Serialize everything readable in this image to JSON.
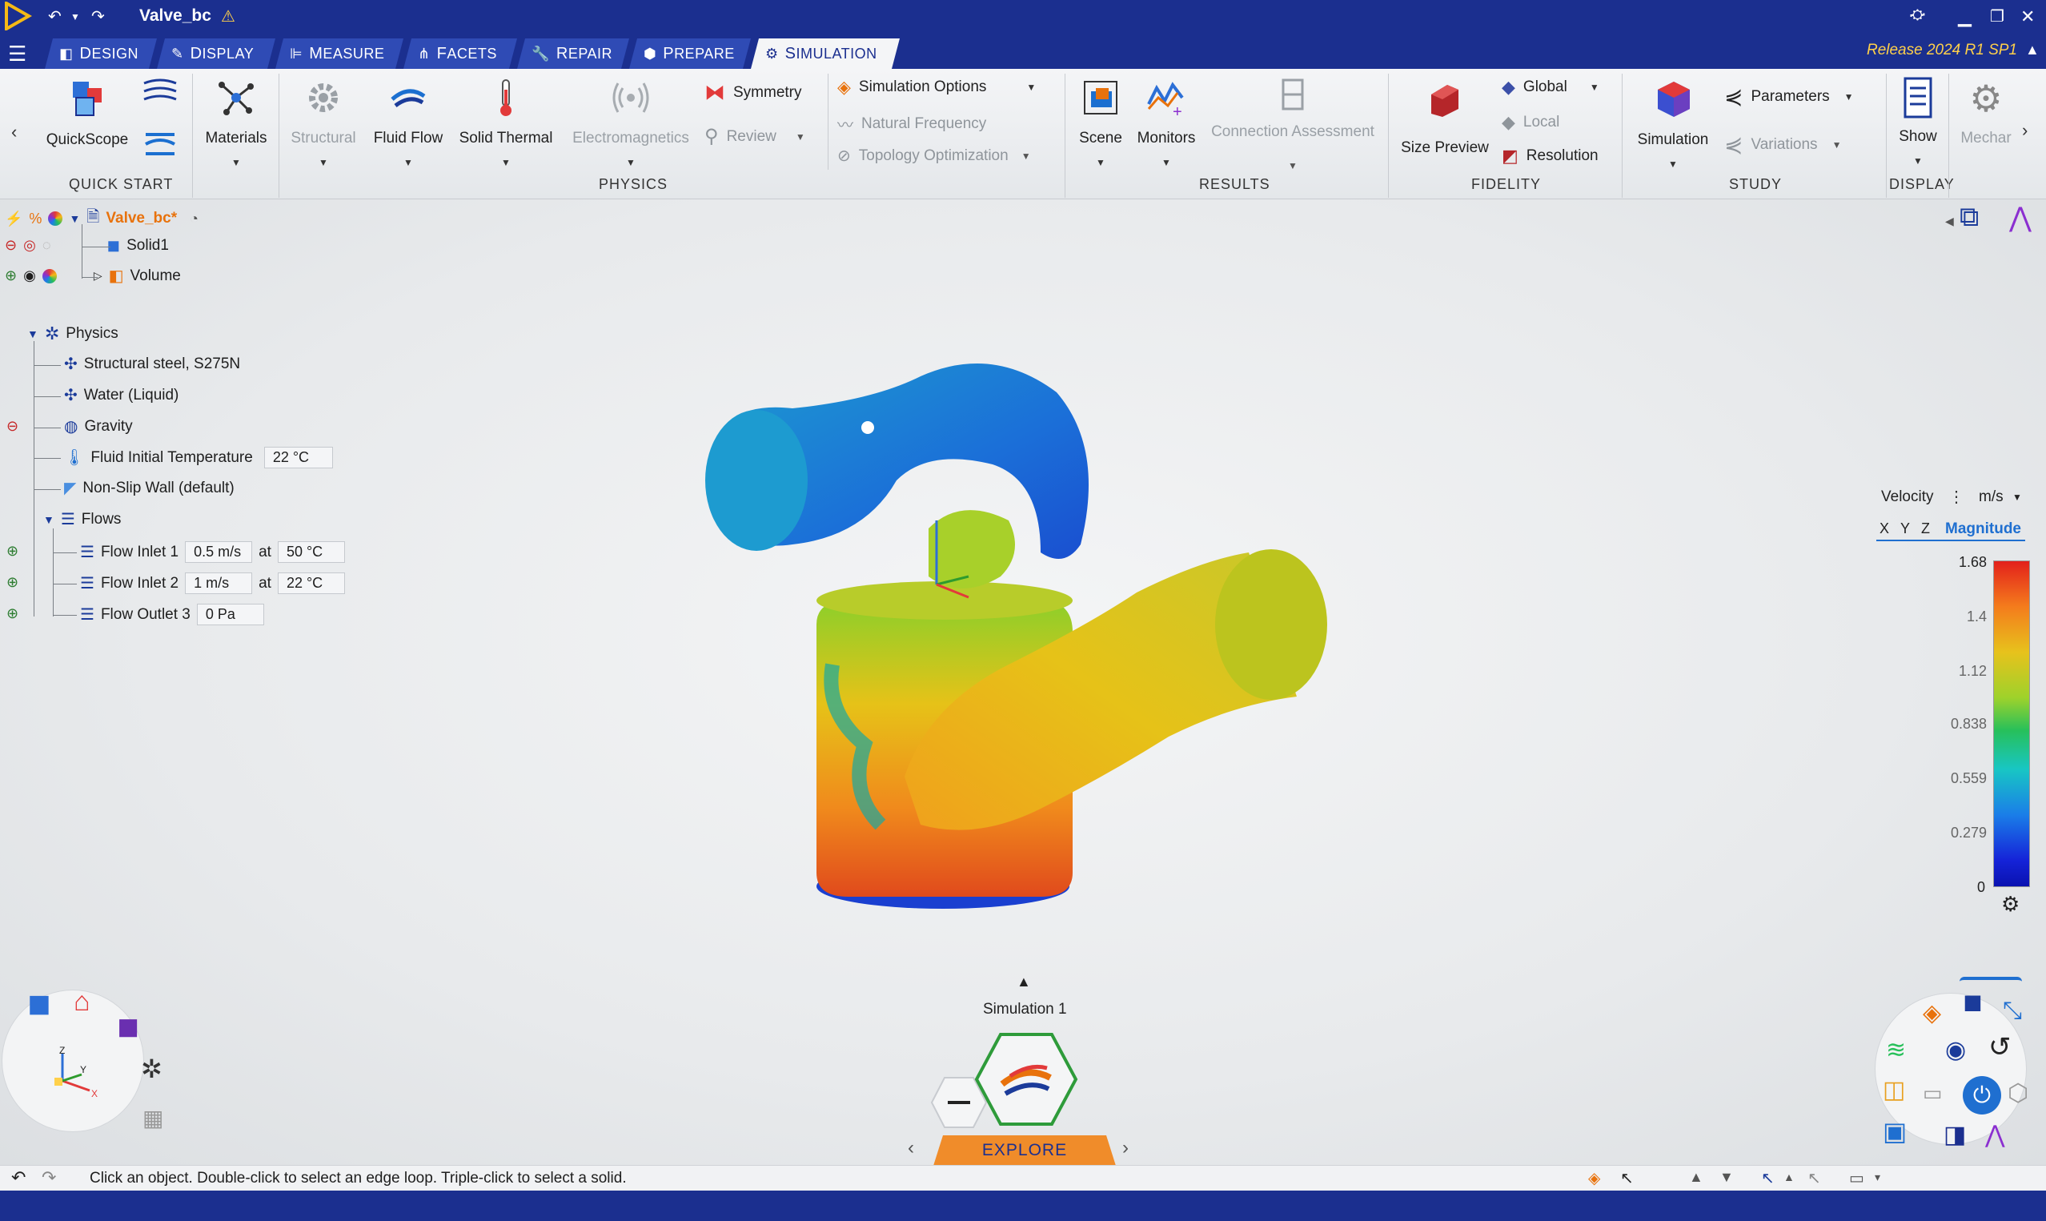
{
  "window": {
    "title": "Valve_bc",
    "release": "Release 2024 R1 SP1"
  },
  "tabs": [
    {
      "first": "D",
      "rest": "ESIGN"
    },
    {
      "first": "D",
      "rest": "ISPLAY"
    },
    {
      "first": "M",
      "rest": "EASURE"
    },
    {
      "first": "F",
      "rest": "ACETS"
    },
    {
      "first": "R",
      "rest": "EPAIR"
    },
    {
      "first": "P",
      "rest": "REPARE"
    },
    {
      "first": "S",
      "rest": "IMULATION"
    }
  ],
  "ribbon": {
    "quickscope": "QuickScope",
    "materials": "Materials",
    "structural": "Structural",
    "fluid_flow": "Fluid Flow",
    "solid_thermal": "Solid Thermal",
    "electromagnetics": "Electromagnetics",
    "symmetry": "Symmetry",
    "review": "Review",
    "simulation_options": "Simulation Options",
    "natural_frequency": "Natural Frequency",
    "topology_optimization": "Topology Optimization",
    "scene": "Scene",
    "monitors": "Monitors",
    "connection_assessment": "Connection Assessment",
    "size_preview": "Size Preview",
    "global": "Global",
    "local": "Local",
    "resolution": "Resolution",
    "simulation": "Simulation",
    "parameters": "Parameters",
    "variations": "Variations",
    "show": "Show",
    "mechanical": "Mechar",
    "groups": {
      "quick_start": "Quick Start",
      "physics": "Physics",
      "results": "Results",
      "fidelity": "Fidelity",
      "study": "Study",
      "display": "Display"
    }
  },
  "tree": {
    "root": "Valve_bc*",
    "solid": "Solid1",
    "volume": "Volume",
    "physics": "Physics",
    "material": "Structural steel, S275N",
    "fluid": "Water (Liquid)",
    "gravity": "Gravity",
    "fluid_temp_label": "Fluid Initial Temperature",
    "fluid_temp_value": "22 °C",
    "wall": "Non-Slip Wall (default)",
    "flows": "Flows",
    "inlet1": {
      "label": "Flow Inlet 1",
      "velocity": "0.5 m/s",
      "at": "at",
      "temp": "50 °C"
    },
    "inlet2": {
      "label": "Flow Inlet 2",
      "velocity": "1 m/s",
      "at": "at",
      "temp": "22 °C"
    },
    "outlet3": {
      "label": "Flow Outlet 3",
      "pressure": "0 Pa"
    }
  },
  "legend": {
    "quantity": "Velocity",
    "unit": "m/s",
    "components": [
      "X",
      "Y",
      "Z"
    ],
    "active_component": "Magnitude",
    "max": "1.68",
    "ticks": [
      "1.4",
      "1.12",
      "0.838",
      "0.559",
      "0.279"
    ],
    "min": "0"
  },
  "explore": {
    "simulation_name": "Simulation 1",
    "mode": "Explore"
  },
  "status": {
    "hint": "Click an object. Double-click to select an edge loop. Triple-click to select a solid."
  },
  "colors": {
    "chrome": "#1b2f8f",
    "tab": "#2f4bb5",
    "accent_orange": "#f08c2a",
    "root_orange": "#e8720c",
    "link_blue": "#1f6fd0"
  }
}
